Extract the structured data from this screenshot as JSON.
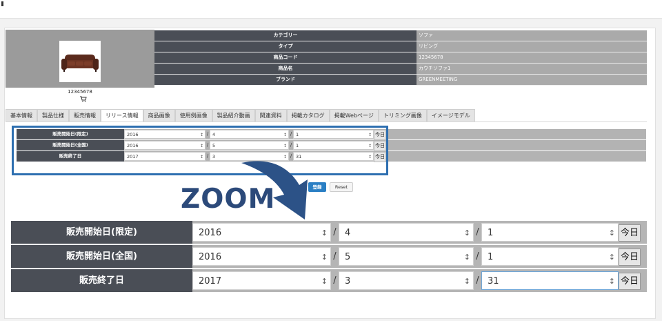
{
  "product": {
    "code_caption": "12345678",
    "cart_icon": "cart-icon",
    "rows": [
      {
        "label": "カテゴリー",
        "value": "ソファ"
      },
      {
        "label": "タイプ",
        "value": "リビング"
      },
      {
        "label": "商品コード",
        "value": "12345678"
      },
      {
        "label": "商品名",
        "value": "カウチソファ1"
      },
      {
        "label": "ブランド",
        "value": "GREENMEETING"
      }
    ]
  },
  "tabs": [
    "基本情報",
    "製品仕様",
    "販売情報",
    "リリース情報",
    "商品画像",
    "使用例画像",
    "製品紹介動画",
    "関連資料",
    "掲載カタログ",
    "掲載Webページ",
    "トリミング画像",
    "イメージモデル"
  ],
  "active_tab": "リリース情報",
  "form": {
    "rows": [
      {
        "label": "販売開始日(限定)",
        "year": "2016",
        "month": "4",
        "day": "1"
      },
      {
        "label": "販売開始日(全国)",
        "year": "2016",
        "month": "5",
        "day": "1"
      },
      {
        "label": "販売終了日",
        "year": "2017",
        "month": "3",
        "day": "31"
      }
    ],
    "separator": "/",
    "today_label": "今日",
    "register_label": "登録",
    "reset_label": "Reset"
  },
  "zoom_label": "ZOOM",
  "colors": {
    "header": "#4a4e56",
    "value_bg": "#aaaaaa",
    "highlight": "#2e6fb0",
    "zoom_text": "#2c4a7a",
    "primary_button": "#2a7fc4"
  }
}
